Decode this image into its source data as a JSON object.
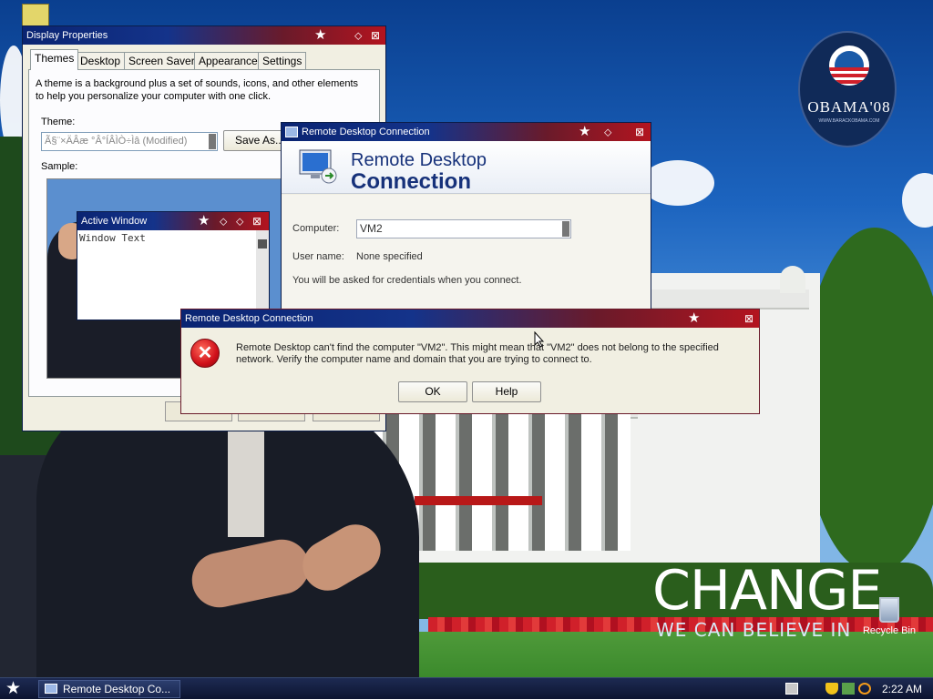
{
  "desktop": {
    "recycle_bin_label": "Recycle Bin",
    "change_text": "CHANGE",
    "change_subtext": "WE CAN BELIEVE IN",
    "obama_logo_text": "OBAMA'08",
    "obama_logo_url": "WWW.BARACKOBAMA.COM"
  },
  "display_properties": {
    "title": "Display Properties",
    "tabs": [
      "Themes",
      "Desktop",
      "Screen Saver",
      "Appearance",
      "Settings"
    ],
    "description": "A theme is a background plus a set of sounds, icons, and other elements to help you personalize your computer with one click.",
    "theme_label": "Theme:",
    "theme_value": "Ã§¨×ÄÂæ °Â°ÍÂÌÒ÷Ìâ (Modified)",
    "save_as_label": "Save As...",
    "sample_label": "Sample:"
  },
  "active_window": {
    "title": "Active Window",
    "text": "Window Text"
  },
  "rdc_window": {
    "title": "Remote Desktop Connection",
    "header_line1": "Remote Desktop",
    "header_line2": "Connection",
    "computer_label": "Computer:",
    "computer_value": "VM2",
    "username_label": "User name:",
    "username_value": "None specified",
    "credentials_note": "You will be asked for credentials when you connect."
  },
  "error_dialog": {
    "title": "Remote Desktop Connection",
    "message": "Remote Desktop can't find the computer \"VM2\". This might mean that \"VM2\" does not belong to the specified network.  Verify the computer name and domain that you are trying to connect to.",
    "ok_label": "OK",
    "help_label": "Help"
  },
  "taskbar": {
    "task_label": "Remote Desktop Co...",
    "clock": "2:22 AM"
  },
  "colors": {
    "title_blue": "#0a2472",
    "title_red": "#b3141f",
    "header_text": "#16317a"
  }
}
